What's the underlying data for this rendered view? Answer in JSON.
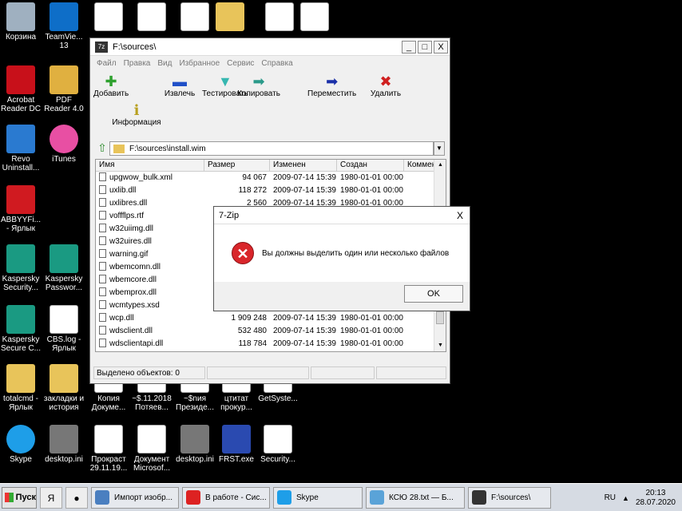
{
  "desktop_icons": [
    {
      "label": "Корзина",
      "icon": "recycle-bin-icon"
    },
    {
      "label": "TeamVie... 13",
      "icon": "teamviewer-icon"
    },
    {
      "label": "",
      "icon": "word-doc-icon"
    },
    {
      "label": "",
      "icon": "word-doc-icon"
    },
    {
      "label": "",
      "icon": "word-doc-icon"
    },
    {
      "label": "",
      "icon": "folder-icon"
    },
    {
      "label": "",
      "icon": "document-icon"
    },
    {
      "label": "",
      "icon": "document-icon"
    },
    {
      "label": "Acrobat Reader DC",
      "icon": "acrobat-icon"
    },
    {
      "label": "PDF Reader 4.0",
      "icon": "pdf-reader-icon"
    },
    {
      "label": "Revo Uninstall...",
      "icon": "revo-icon"
    },
    {
      "label": "iTunes",
      "icon": "itunes-icon"
    },
    {
      "label": "ABBYYFi... - Ярлык",
      "icon": "abbyy-icon"
    },
    {
      "label": "Kaspersky Security...",
      "icon": "kaspersky-icon"
    },
    {
      "label": "Kaspersky Passwor...",
      "icon": "kaspersky-password-icon"
    },
    {
      "label": "Kaspersky Secure C...",
      "icon": "kaspersky-secure-icon"
    },
    {
      "label": "CBS.log - Ярлык",
      "icon": "log-file-icon"
    },
    {
      "label": "totalcmd - Ярлык",
      "icon": "folder-icon"
    },
    {
      "label": "закладки и история",
      "icon": "folder-icon"
    },
    {
      "label": "Копия Докуме...",
      "icon": "document-icon"
    },
    {
      "label": "~$.11.2018 Потяев...",
      "icon": "word-doc-icon"
    },
    {
      "label": "~$nия Президе...",
      "icon": "word-doc-icon"
    },
    {
      "label": "цтитат прокур...",
      "icon": "word-doc-icon"
    },
    {
      "label": "GetSyste...",
      "icon": "document-icon"
    },
    {
      "label": "Skype",
      "icon": "skype-icon"
    },
    {
      "label": "desktop.ini",
      "icon": "settings-file-icon"
    },
    {
      "label": "Прокраст 29.11.19...",
      "icon": "document-icon"
    },
    {
      "label": "Документ Microsof...",
      "icon": "word-doc-icon"
    },
    {
      "label": "desktop.ini",
      "icon": "settings-file-icon"
    },
    {
      "label": "FRST.exe",
      "icon": "frst-icon"
    },
    {
      "label": "Security...",
      "icon": "7zip-file-icon"
    }
  ],
  "window": {
    "title": "F:\\sources\\",
    "app_icon": "7z",
    "min": "_",
    "max": "□",
    "close": "X",
    "menu": [
      "Файл",
      "Правка",
      "Вид",
      "Избранное",
      "Сервис",
      "Справка"
    ],
    "toolbar": [
      {
        "label": "Добавить",
        "icon": "add-icon",
        "glyph": "✚",
        "color": "#2fa12f"
      },
      {
        "label": "Извлечь",
        "icon": "extract-icon",
        "glyph": "▬",
        "color": "#2050c8"
      },
      {
        "label": "Тестировать",
        "icon": "test-icon",
        "glyph": "▼",
        "color": "#36b7b0"
      },
      {
        "label": "Копировать",
        "icon": "copy-icon",
        "glyph": "➡",
        "color": "#2a9a8a"
      },
      {
        "label": "Переместить",
        "icon": "move-icon",
        "glyph": "➡",
        "color": "#1a2fa8"
      },
      {
        "label": "Удалить",
        "icon": "delete-icon",
        "glyph": "✖",
        "color": "#d02020"
      },
      {
        "label": "Информация",
        "icon": "info-icon",
        "glyph": "ℹ",
        "color": "#b8a020"
      }
    ],
    "address": "F:\\sources\\install.wim",
    "columns": [
      "Имя",
      "Размер",
      "Изменен",
      "Создан",
      "Коммен"
    ],
    "files": [
      {
        "name": "upgwow_bulk.xml",
        "size": "94 067",
        "modified": "2009-07-14 15:39",
        "created": "1980-01-01 00:00"
      },
      {
        "name": "uxlib.dll",
        "size": "118 272",
        "modified": "2009-07-14 15:39",
        "created": "1980-01-01 00:00"
      },
      {
        "name": "uxlibres.dll",
        "size": "2 560",
        "modified": "2009-07-14 15:39",
        "created": "1980-01-01 00:00"
      },
      {
        "name": "voffflps.rtf",
        "size": "",
        "modified": "",
        "created": ""
      },
      {
        "name": "w32uiimg.dll",
        "size": "",
        "modified": "",
        "created": ""
      },
      {
        "name": "w32uires.dll",
        "size": "",
        "modified": "",
        "created": ""
      },
      {
        "name": "warning.gif",
        "size": "",
        "modified": "",
        "created": ""
      },
      {
        "name": "wbemcomn.dll",
        "size": "",
        "modified": "",
        "created": ""
      },
      {
        "name": "wbemcore.dll",
        "size": "",
        "modified": "",
        "created": ""
      },
      {
        "name": "wbemprox.dll",
        "size": "",
        "modified": "",
        "created": ""
      },
      {
        "name": "wcmtypes.xsd",
        "size": "",
        "modified": "",
        "created": ""
      },
      {
        "name": "wcp.dll",
        "size": "1 909 248",
        "modified": "2009-07-14 15:39",
        "created": "1980-01-01 00:00"
      },
      {
        "name": "wdsclient.dll",
        "size": "532 480",
        "modified": "2009-07-14 15:39",
        "created": "1980-01-01 00:00"
      },
      {
        "name": "wdsclientapi.dll",
        "size": "118 784",
        "modified": "2009-07-14 15:39",
        "created": "1980-01-01 00:00"
      }
    ],
    "status": "Выделено объектов: 0"
  },
  "dialog": {
    "title": "7-Zip",
    "close": "X",
    "message": "Вы должны выделить один или несколько файлов",
    "ok": "OK"
  },
  "taskbar": {
    "start": "Пуск",
    "buttons": [
      {
        "label": "Импорт изобр...",
        "color": "#4a7fc0"
      },
      {
        "label": "В работе - Сис...",
        "color": "#d22"
      },
      {
        "label": "Skype",
        "color": "#1e9ee8"
      },
      {
        "label": "КСЮ 28.txt — Б...",
        "color": "#5aa3d8"
      },
      {
        "label": "F:\\sources\\",
        "color": "#333"
      }
    ],
    "lang": "RU",
    "time": "20:13",
    "date": "28.07.2020"
  }
}
